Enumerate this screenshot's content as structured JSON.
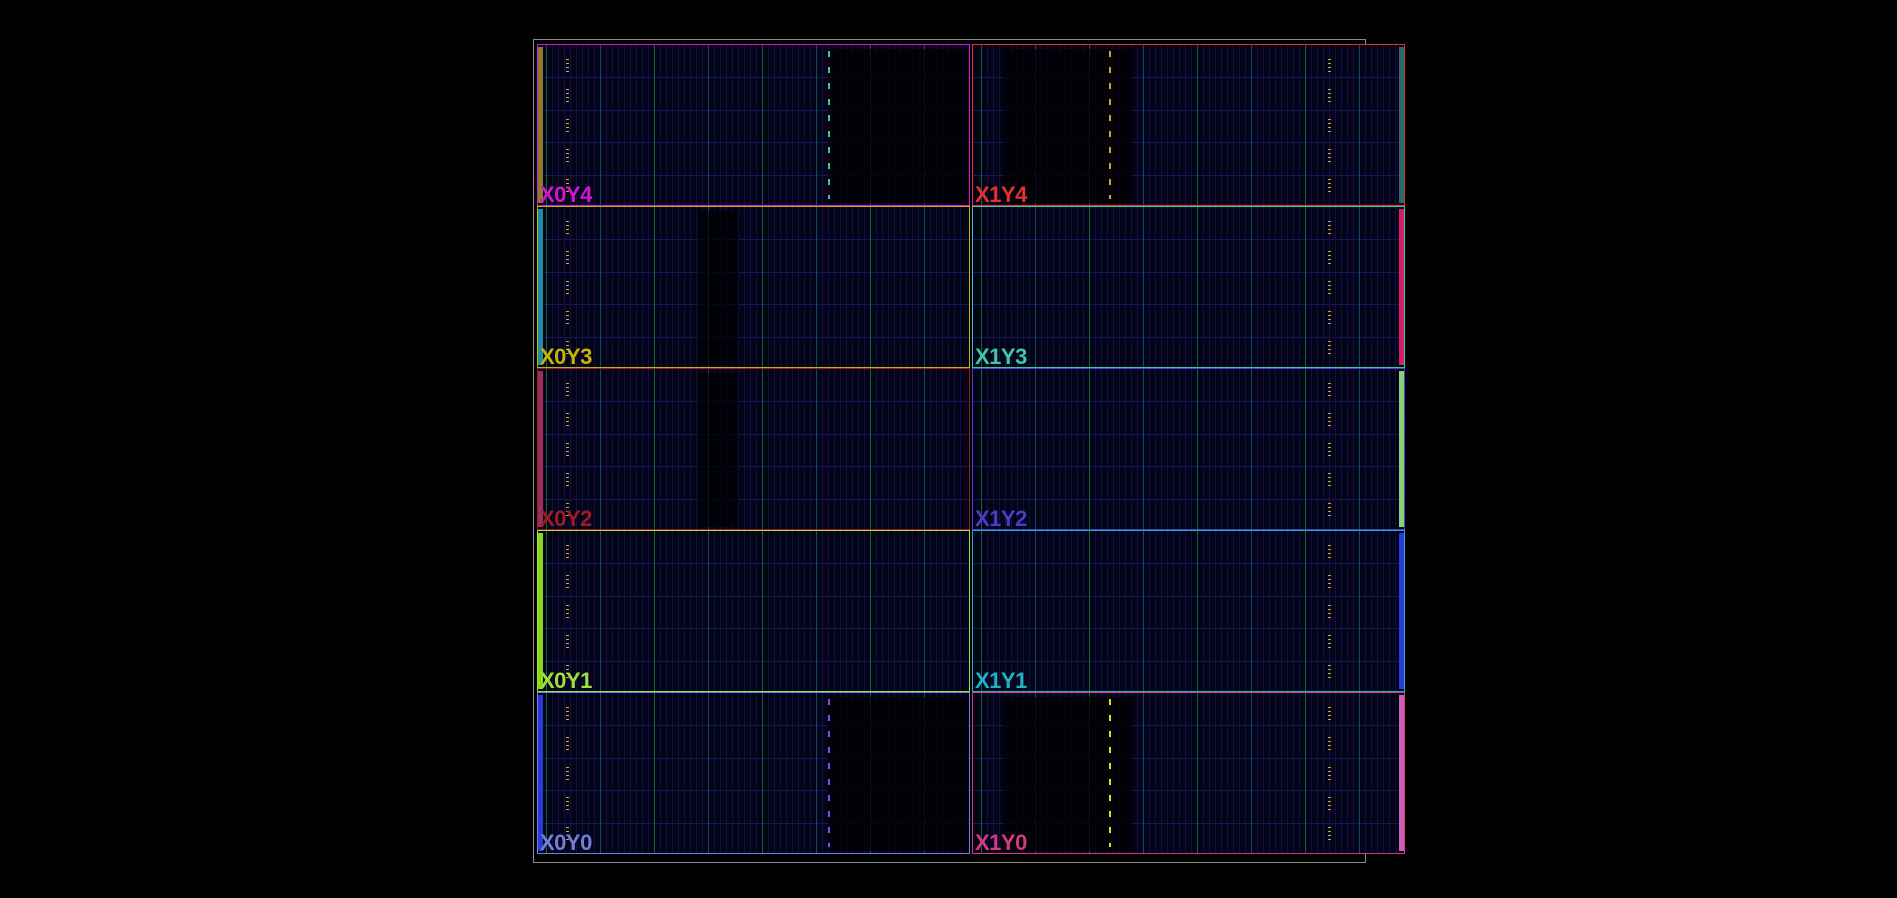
{
  "view": "Device floorplan",
  "regions": [
    {
      "name": "X0Y4",
      "color": "#d216d2"
    },
    {
      "name": "X1Y4",
      "color": "#e0332b"
    },
    {
      "name": "X0Y3",
      "color": "#c8b400"
    },
    {
      "name": "X1Y3",
      "color": "#3fc7a6"
    },
    {
      "name": "X0Y2",
      "color": "#9b1c24"
    },
    {
      "name": "X1Y2",
      "color": "#4b3bc8"
    },
    {
      "name": "X0Y1",
      "color": "#9fe03b"
    },
    {
      "name": "X1Y1",
      "color": "#1fb2c4"
    },
    {
      "name": "X0Y0",
      "color": "#6f7fd8"
    },
    {
      "name": "X1Y0",
      "color": "#d23c7c"
    }
  ],
  "io_bar_colors": {
    "X0Y4": "#8a7a2a",
    "X1Y4": "#2a6a6a",
    "X0Y3": "#1f8aa0",
    "X1Y3": "#d81c6e",
    "X0Y2": "#a02a5a",
    "X1Y2": "#8ad07a",
    "X0Y1": "#8ad81c",
    "X1Y1": "#2a3ad8",
    "X0Y0": "#2a3ad8",
    "X1Y0": "#c860b4"
  }
}
